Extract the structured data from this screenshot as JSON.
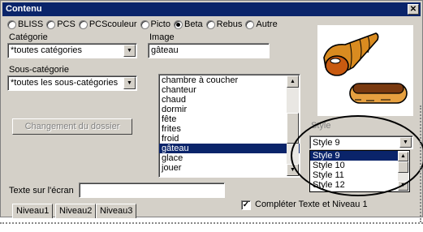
{
  "window": {
    "title": "Contenu",
    "close_label": "✕"
  },
  "symbol_sets": [
    {
      "label": "BLISS",
      "selected": false
    },
    {
      "label": "PCS",
      "selected": false
    },
    {
      "label": "PCScouleur",
      "selected": false
    },
    {
      "label": "Picto",
      "selected": false
    },
    {
      "label": "Beta",
      "selected": true
    },
    {
      "label": "Rebus",
      "selected": false
    },
    {
      "label": "Autre",
      "selected": false
    }
  ],
  "categorie": {
    "label": "Catégorie",
    "value": "*toutes catégories"
  },
  "sous_categorie": {
    "label": "Sous-catégorie",
    "value": "*toutes les sous-catégories"
  },
  "change_folder_button": "Changement du dossier",
  "image": {
    "label": "Image",
    "value": "gâteau",
    "list": [
      "chambre à coucher",
      "chanteur",
      "chaud",
      "dormir",
      "fête",
      "frites",
      "froid",
      "gâteau",
      "glace",
      "jouer"
    ],
    "selected": "gâteau"
  },
  "style": {
    "label": "Style",
    "value": "Style 9",
    "options": [
      "Style 9",
      "Style 10",
      "Style 11",
      "Style 12"
    ],
    "selected": "Style 9"
  },
  "texte_ecran": {
    "label": "Texte sur l'écran",
    "value": ""
  },
  "completer": {
    "label": "Compléter Texte et Niveau 1",
    "checked": true
  },
  "tabs": [
    "Niveau1",
    "Niveau2",
    "Niveau3"
  ],
  "preview_image": "pastries-picture"
}
